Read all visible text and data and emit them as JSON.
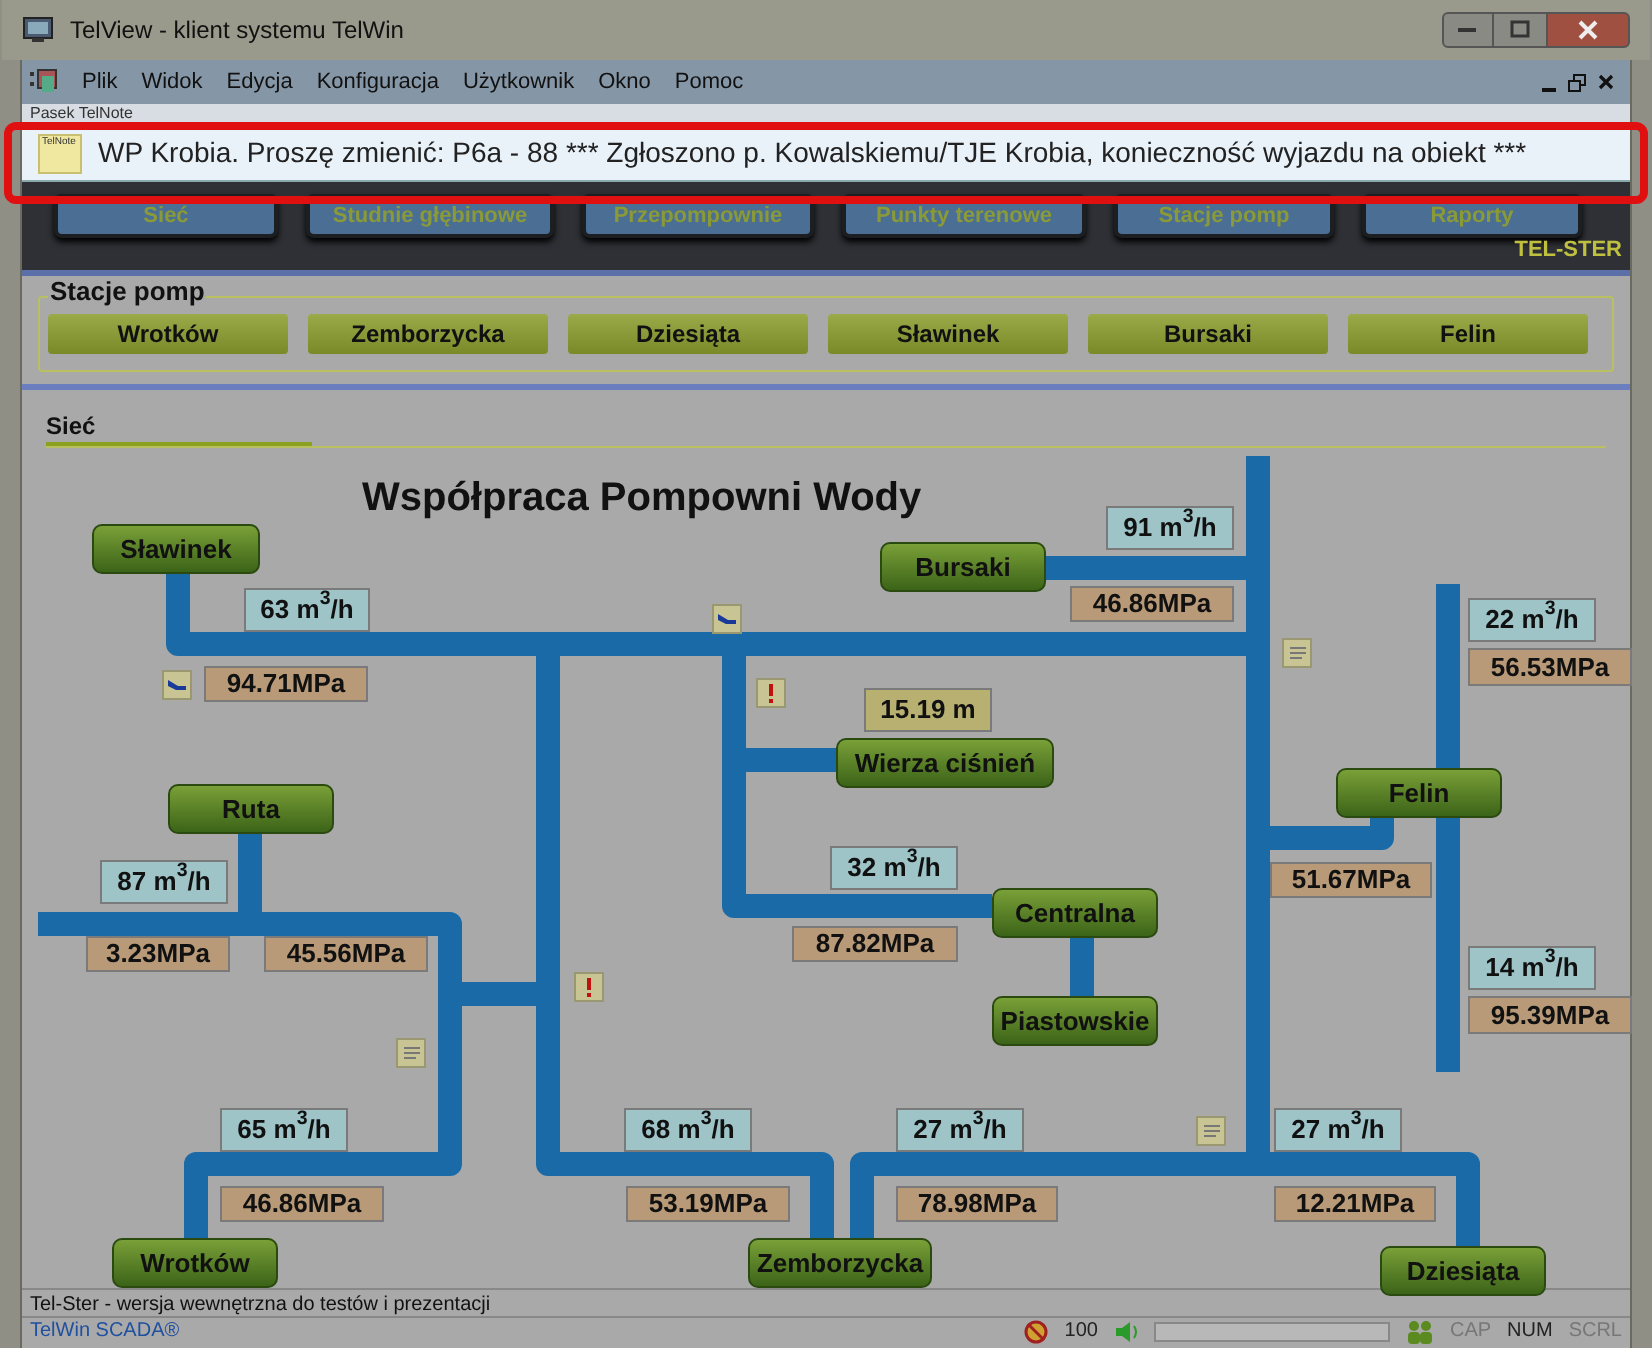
{
  "window": {
    "title": "TelView - klient systemu TelWin"
  },
  "menu": [
    "Plik",
    "Widok",
    "Edycja",
    "Konfiguracja",
    "Użytkownik",
    "Okno",
    "Pomoc"
  ],
  "telnote": {
    "label": "Pasek TelNote",
    "icon_text": "TelNote",
    "text": "WP Krobia. Proszę zmienić: P6a - 88 *** Zgłoszono p. Kowalskiemu/TJE Krobia, konieczność wyjazdu na obiekt ***"
  },
  "nav": [
    "Sieć",
    "Studnie głębinowe",
    "Przepompownie",
    "Punkty terenowe",
    "Stacje pomp",
    "Raporty"
  ],
  "brand": "TEL-STER",
  "pump_stations": {
    "title": "Stacje pomp",
    "buttons": [
      "Wrotków",
      "Zemborzycka",
      "Dziesiąta",
      "Sławinek",
      "Bursaki",
      "Felin"
    ]
  },
  "section": "Sieć",
  "diagram": {
    "title": "Współpraca Pompowni Wody",
    "nodes": [
      "Sławinek",
      "Ruta",
      "Wrotków",
      "Zemborzycka",
      "Bursaki",
      "Wierza ciśnień",
      "Centralna",
      "Piastowskie",
      "Felin",
      "Dziesiąta"
    ],
    "labels": [
      {
        "kind": "flow",
        "text": "91 m$^{3}$/h"
      },
      {
        "kind": "flow",
        "text": "63 m$^{3}$/h"
      },
      {
        "kind": "pressure",
        "text": "46.86MPa"
      },
      {
        "kind": "flow",
        "text": "22 m$^{3}$/h"
      },
      {
        "kind": "pressure",
        "text": "56.53MPa"
      },
      {
        "kind": "pressure",
        "text": "94.71MPa"
      },
      {
        "kind": "level",
        "text": "15.19 m"
      },
      {
        "kind": "flow",
        "text": "87 m$^{3}$/h"
      },
      {
        "kind": "flow",
        "text": "32 m$^{3}$/h"
      },
      {
        "kind": "pressure",
        "text": "51.67MPa"
      },
      {
        "kind": "pressure",
        "text": "3.23MPa"
      },
      {
        "kind": "pressure",
        "text": "45.56MPa"
      },
      {
        "kind": "pressure",
        "text": "87.82MPa"
      },
      {
        "kind": "flow",
        "text": "14 m$^{3}$/h"
      },
      {
        "kind": "pressure",
        "text": "95.39MPa"
      },
      {
        "kind": "flow",
        "text": "65 m$^{3}$/h"
      },
      {
        "kind": "flow",
        "text": "68 m$^{3}$/h"
      },
      {
        "kind": "flow",
        "text": "27 m$^{3}$/h"
      },
      {
        "kind": "flow",
        "text": "27 m$^{3}$/h"
      },
      {
        "kind": "pressure",
        "text": "46.86MPa"
      },
      {
        "kind": "pressure",
        "text": "53.19MPa"
      },
      {
        "kind": "pressure",
        "text": "78.98MPa"
      },
      {
        "kind": "pressure",
        "text": "12.21MPa"
      }
    ],
    "markers": [
      {
        "kind": "pump"
      },
      {
        "kind": "pump"
      },
      {
        "kind": "alarm"
      },
      {
        "kind": "alarm"
      },
      {
        "kind": "note"
      },
      {
        "kind": "note"
      },
      {
        "kind": "note"
      }
    ]
  },
  "status_bar": {
    "message": "Tel-Ster - wersja wewnętrzna do testów i prezentacji",
    "app": "TelWin SCADA®",
    "volume": "100",
    "indicators": [
      {
        "label": "CAP",
        "on": false
      },
      {
        "label": "NUM",
        "on": true
      },
      {
        "label": "SCRL",
        "on": false
      }
    ]
  }
}
